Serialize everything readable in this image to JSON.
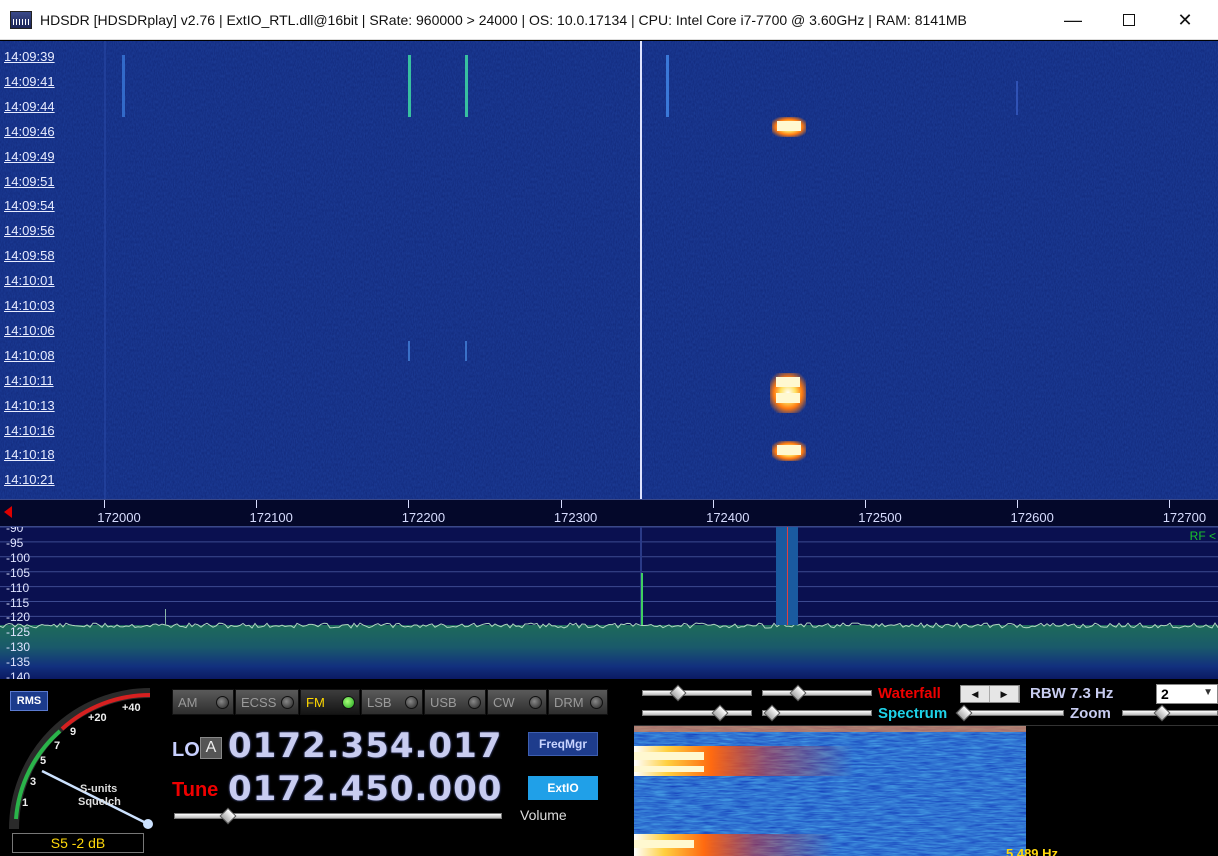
{
  "window": {
    "title": "HDSDR  [HDSDRplay]  v2.76   | ExtIO_RTL.dll@16bit  |  SRate: 960000 > 24000  |  OS: 10.0.17134   |  CPU: Intel Core i7-7700 @ 3.60GHz  |  RAM: 8141MB",
    "minimize": "—",
    "close": "✕",
    "icons": [
      "hdsdr-app-icon",
      "minimize-icon",
      "maximize-icon",
      "close-icon"
    ]
  },
  "waterfall": {
    "time_labels": [
      "14:09:39",
      "14:09:41",
      "14:09:44",
      "14:09:46",
      "14:09:49",
      "14:09:51",
      "14:09:54",
      "14:09:56",
      "14:09:58",
      "14:10:01",
      "14:10:03",
      "14:10:06",
      "14:10:08",
      "14:10:11",
      "14:10:13",
      "14:10:16",
      "14:10:18",
      "14:10:21"
    ],
    "background_color": "#102a78",
    "signal_color": "#ffb020"
  },
  "freq_axis": {
    "labels": [
      "172000",
      "172100",
      "172200",
      "172300",
      "172400",
      "172500",
      "172600",
      "172700"
    ]
  },
  "spectrum": {
    "db_labels": [
      "-90",
      "-95",
      "-100",
      "-105",
      "-110",
      "-115",
      "-120",
      "-125",
      "-130",
      "-135",
      "-140"
    ],
    "rf_label": "RF <",
    "filter_color": "#1a5aa0"
  },
  "panel": {
    "rms_label": "RMS",
    "smeter": {
      "readout": "S5 -2 dB",
      "caption_line1": "S-units",
      "caption_line2": "Squelch",
      "scale": [
        "1",
        "3",
        "5",
        "7",
        "9",
        "+20",
        "+40"
      ]
    },
    "modes": [
      {
        "label": "AM",
        "active": false
      },
      {
        "label": "ECSS",
        "active": false
      },
      {
        "label": "FM",
        "active": true
      },
      {
        "label": "LSB",
        "active": false
      },
      {
        "label": "USB",
        "active": false
      },
      {
        "label": "CW",
        "active": false
      },
      {
        "label": "DRM",
        "active": false
      }
    ],
    "lo_label": "LO",
    "lo_lock": "A",
    "lo_freq": "0172.354.017",
    "tune_label": "Tune",
    "tune_freq": "0172.450.000",
    "freqmgr_label": "FreqMgr",
    "extio_label": "ExtIO",
    "volume_label": "Volume",
    "waterfall_label": "Waterfall",
    "spectrum_label": "Spectrum",
    "zoom_label": "Zoom",
    "rbw_label": "RBW  7.3 Hz",
    "rbw_select_value": "2",
    "arrow_left": "◀",
    "arrow_right": "▶",
    "audio_hz_label": "5,489 Hz"
  }
}
